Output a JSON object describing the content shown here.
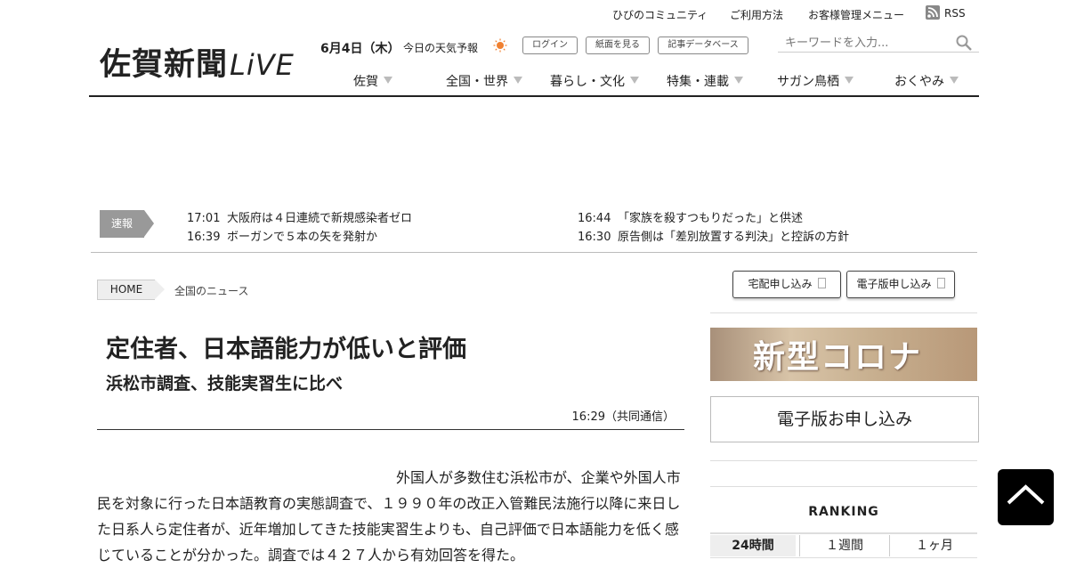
{
  "header": {
    "util_links": [
      "ひびのコミュニティ",
      "ご利用方法",
      "お客様管理メニュー"
    ],
    "rss_label": "RSS",
    "logo_main": "佐賀新聞",
    "logo_live": "LiVE",
    "date": "6月4日（木）",
    "weather_label": "今日の天気予報",
    "buttons": [
      "ログイン",
      "紙面を見る",
      "記事データベース"
    ],
    "search_placeholder": "キーワードを入力..."
  },
  "nav": [
    "佐賀",
    "全国・世界",
    "暮らし・文化",
    "特集・連載",
    "サガン鳥栖",
    "おくやみ"
  ],
  "breaking": {
    "tag": "速報",
    "items": [
      {
        "time": "17:01",
        "text": "大阪府は４日連続で新規感染者ゼロ"
      },
      {
        "time": "16:44",
        "text": "「家族を殺すつもりだった」と供述"
      },
      {
        "time": "16:39",
        "text": "ボーガンで５本の矢を発射か"
      },
      {
        "time": "16:30",
        "text": "原告側は「差別放置する判決」と控訴の方針"
      }
    ]
  },
  "breadcrumb": {
    "home": "HOME",
    "current": "全国のニュース"
  },
  "article": {
    "headline": "定住者、日本語能力が低いと評価",
    "subhead": "浜松市調査、技能実習生に比べ",
    "byline": "16:29（共同通信）",
    "body": "外国人が多数住む浜松市が、企業や外国人市民を対象に行った日本語教育の実態調査で、１９９０年の改正入管難民法施行以降に来日した日系人ら定住者が、近年増加してきた技能実習生よりも、自己評価で日本語能力を低く感じていることが分かった。調査では４２７人から有効回答を得た。"
  },
  "sidebar": {
    "btn_home_delivery": "宅配申し込み",
    "btn_digital": "電子版申し込み",
    "corona_banner": "新型コロナ",
    "digital_box": "電子版お申し込み",
    "ranking_title": "RANKING",
    "ranking_tabs": [
      "24時間",
      "１週間",
      "１ヶ月"
    ]
  }
}
